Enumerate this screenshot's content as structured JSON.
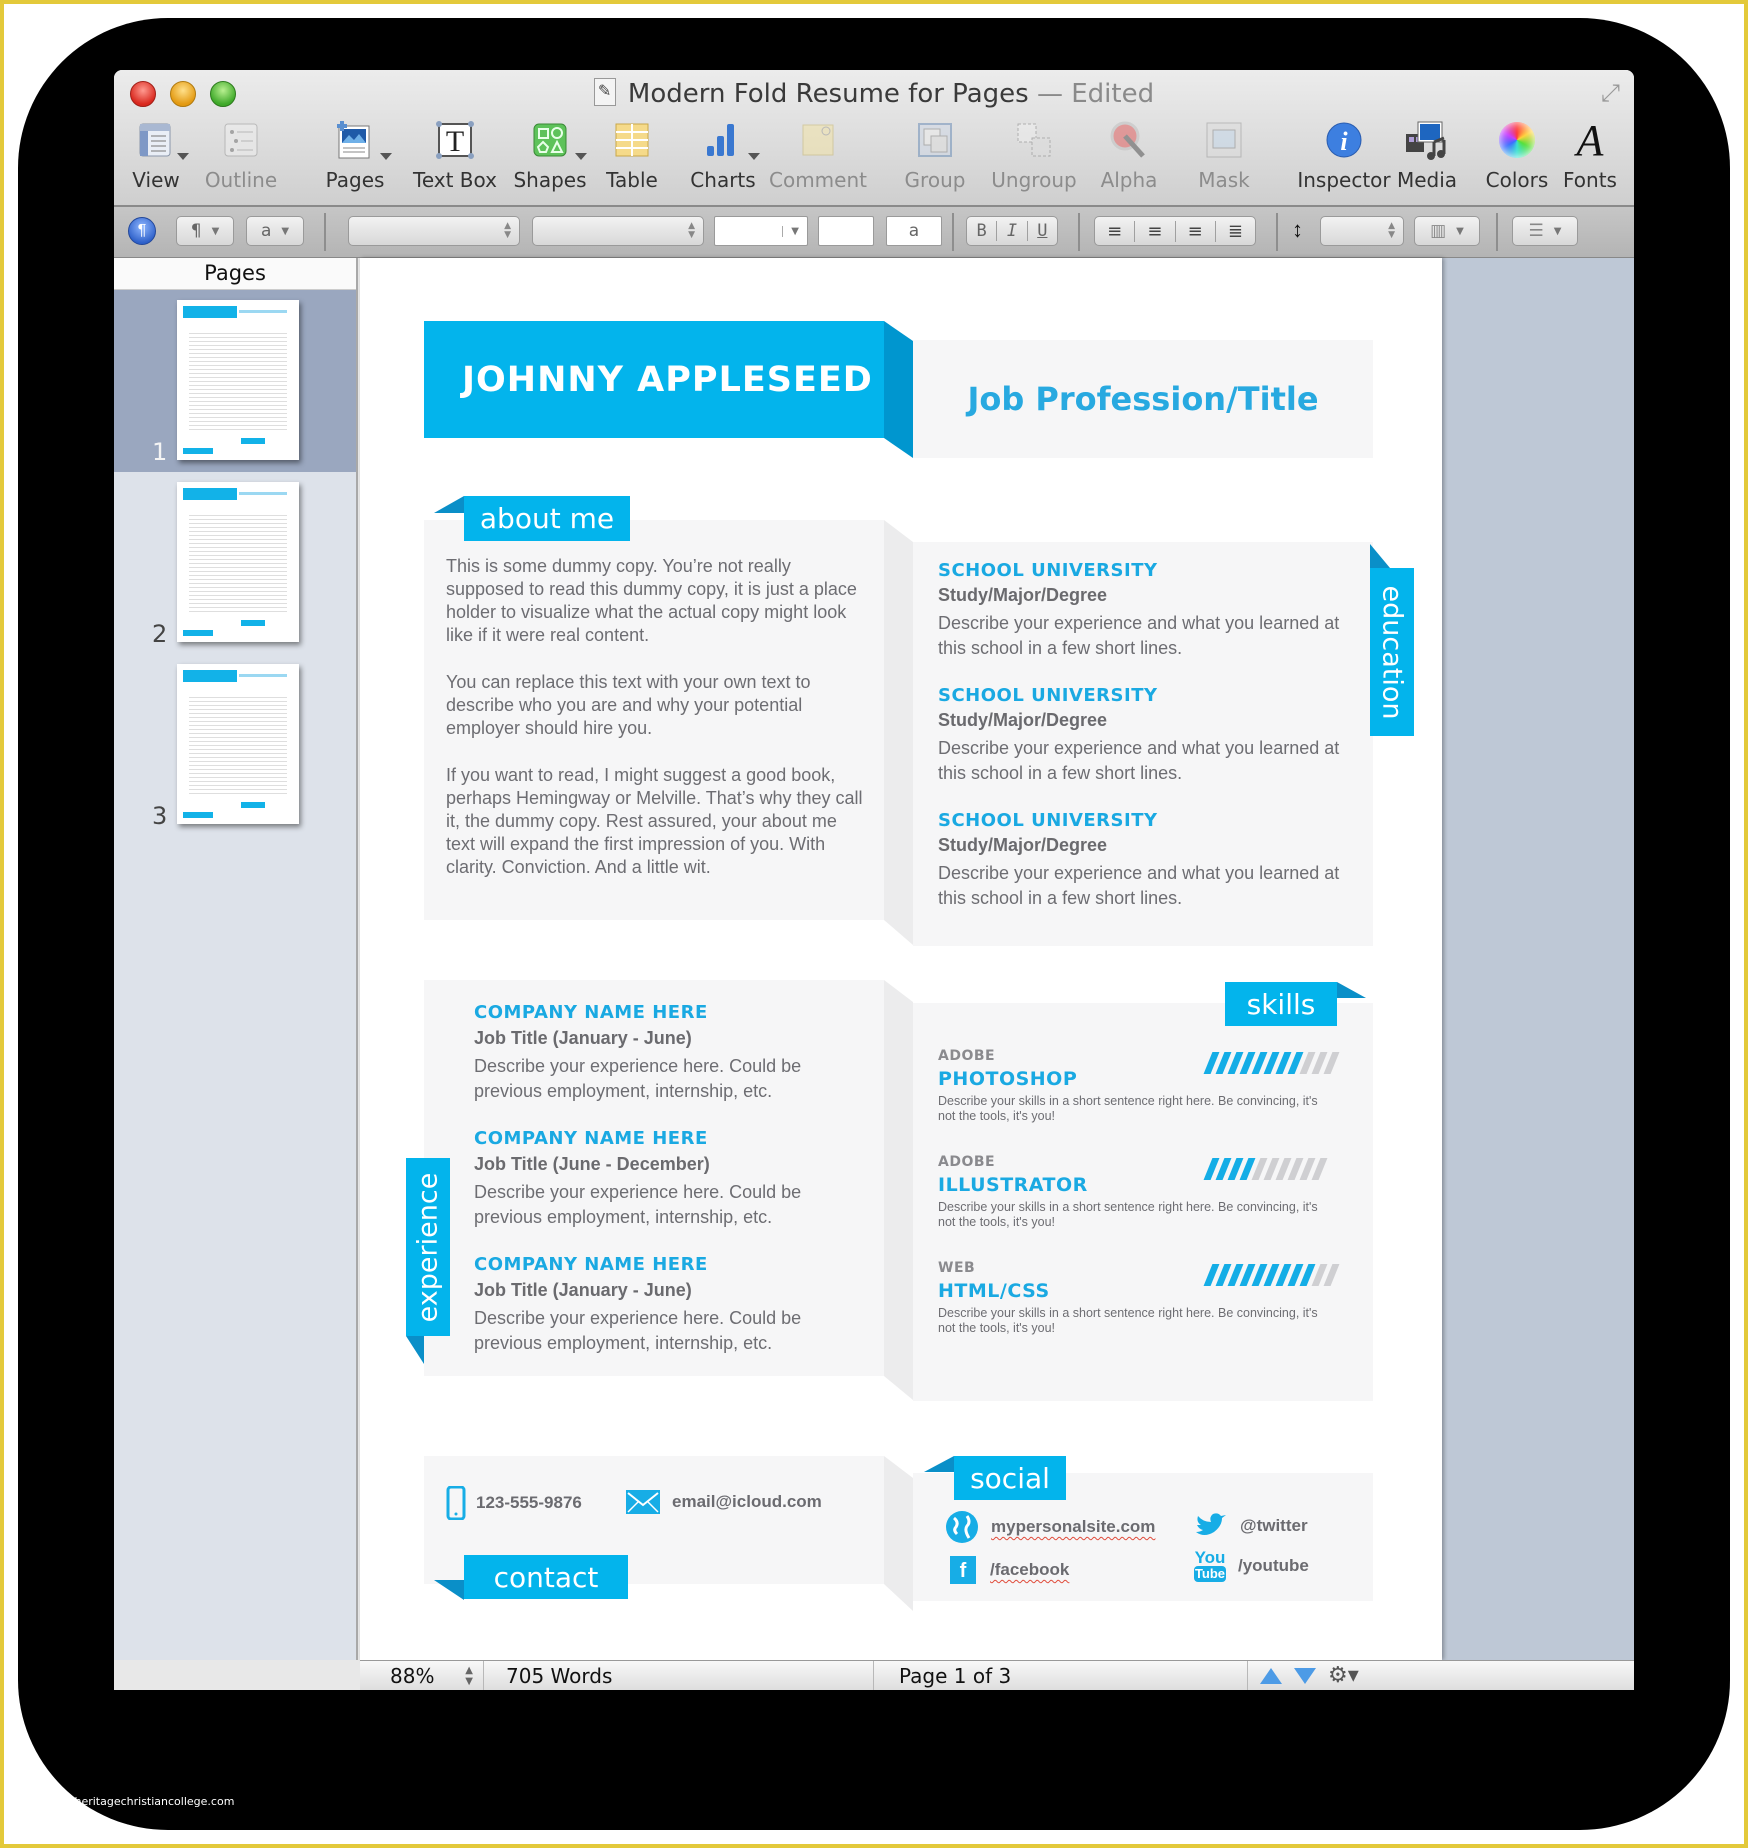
{
  "watermark": "www.heritagechristiancollege.com",
  "window": {
    "title": "Modern Fold Resume for Pages",
    "title_suffix": "— Edited"
  },
  "toolbar": {
    "items": [
      {
        "label": "View",
        "icon": "view-icon",
        "enabled": true
      },
      {
        "label": "Outline",
        "icon": "outline-icon",
        "enabled": false
      },
      {
        "label": "Pages",
        "icon": "pages-icon",
        "enabled": true
      },
      {
        "label": "Text Box",
        "icon": "text-box-icon",
        "enabled": true
      },
      {
        "label": "Shapes",
        "icon": "shapes-icon",
        "enabled": true
      },
      {
        "label": "Table",
        "icon": "table-icon",
        "enabled": true
      },
      {
        "label": "Charts",
        "icon": "charts-icon",
        "enabled": true
      },
      {
        "label": "Comment",
        "icon": "comment-icon",
        "enabled": false
      },
      {
        "label": "Group",
        "icon": "group-icon",
        "enabled": false
      },
      {
        "label": "Ungroup",
        "icon": "ungroup-icon",
        "enabled": false
      },
      {
        "label": "Alpha",
        "icon": "alpha-icon",
        "enabled": false
      },
      {
        "label": "Mask",
        "icon": "mask-icon",
        "enabled": false
      },
      {
        "label": "Inspector",
        "icon": "inspector-icon",
        "enabled": true
      },
      {
        "label": "Media",
        "icon": "media-icon",
        "enabled": true
      },
      {
        "label": "Colors",
        "icon": "colors-icon",
        "enabled": true
      },
      {
        "label": "Fonts",
        "icon": "fonts-icon",
        "enabled": true
      }
    ]
  },
  "formatbar": {
    "paragraph_style_glyph": "¶",
    "char_style_glyph": "a",
    "text_color_glyph": "a",
    "bold": "B",
    "italic": "I",
    "underline": "U"
  },
  "sidebar": {
    "header": "Pages",
    "pages": [
      {
        "number": "1",
        "selected": true
      },
      {
        "number": "2",
        "selected": false
      },
      {
        "number": "3",
        "selected": false
      }
    ]
  },
  "resume": {
    "accent_color": "#03b4ec",
    "name": "JOHNNY APPLESEED",
    "job_title": "Job Profession/Title",
    "about": {
      "tag": "about me",
      "paragraphs": [
        "This is some dummy copy. You’re not really supposed to read this dummy copy, it is just a place holder to visualize what the actual copy might look like if it were real content.",
        "You can replace this text with your own text to describe who you are and why your potential employer should hire you.",
        "If you want to read, I might suggest a good book, perhaps Hemingway or Melville. That’s why they call it, the dummy copy. Rest assured, your about me text will expand the first impression of you. With clarity. Conviction. And a little wit."
      ]
    },
    "education": {
      "tag": "education",
      "entries": [
        {
          "school": "SCHOOL UNIVERSITY",
          "degree": "Study/Major/Degree",
          "desc": "Describe your experience and what you learned at this school in a few short lines."
        },
        {
          "school": "SCHOOL UNIVERSITY",
          "degree": "Study/Major/Degree",
          "desc": "Describe your experience and what you learned at this school in a few short lines."
        },
        {
          "school": "SCHOOL UNIVERSITY",
          "degree": "Study/Major/Degree",
          "desc": "Describe your experience and what you learned at this school in a few short lines."
        }
      ]
    },
    "experience": {
      "tag": "experience",
      "entries": [
        {
          "company": "COMPANY NAME HERE",
          "title": "Job Title (January - June)",
          "desc": "Describe your experience here. Could be previous employment, internship, etc."
        },
        {
          "company": "COMPANY NAME HERE",
          "title": "Job Title (June - December)",
          "desc": "Describe your experience here. Could be previous employment, internship, etc."
        },
        {
          "company": "COMPANY NAME HERE",
          "title": "Job Title (January - June)",
          "desc": "Describe your experience here. Could be previous employment, internship, etc."
        }
      ]
    },
    "skills": {
      "tag": "skills",
      "entries": [
        {
          "category": "ADOBE",
          "name": "PHOTOSHOP",
          "desc": "Describe your skills in a short sentence right here. Be convincing, it's not the tools, it's you!",
          "level": 8,
          "max": 11
        },
        {
          "category": "ADOBE",
          "name": "ILLUSTRATOR",
          "desc": "Describe your skills in a short sentence right here. Be convincing, it's not the tools, it's you!",
          "level": 4,
          "max": 10
        },
        {
          "category": "WEB",
          "name": "HTML/CSS",
          "desc": "Describe your skills in a short sentence right here. Be convincing, it's not the tools, it's you!",
          "level": 9,
          "max": 11
        }
      ]
    },
    "contact": {
      "tag": "contact",
      "phone": "123-555-9876",
      "email": "email@icloud.com"
    },
    "social": {
      "tag": "social",
      "website": "mypersonalsite.com",
      "twitter": "@twitter",
      "facebook": "/facebook",
      "youtube": "/youtube",
      "youtube_icon_top": "You",
      "youtube_icon_bottom": "Tube",
      "facebook_icon": "f"
    }
  },
  "statusbar": {
    "zoom": "88%",
    "word_count": "705 Words",
    "page_info": "Page 1 of 3"
  }
}
